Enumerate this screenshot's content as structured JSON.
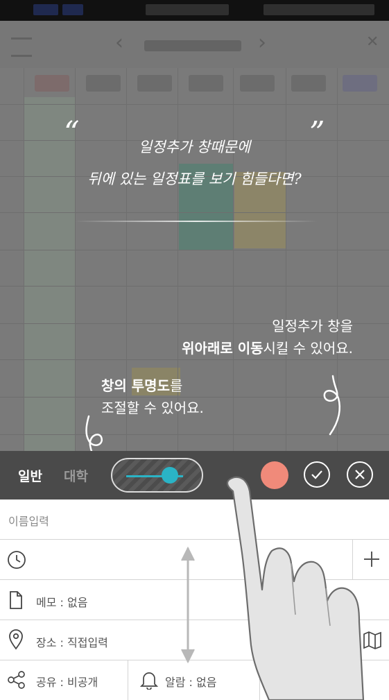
{
  "overlay": {
    "quote_open": "“",
    "quote_close": "”",
    "script_line1": "일정추가 창때문에",
    "script_line2": "뒤에 있는 일정표를 보기 힘들다면?",
    "hint_move_line1": "일정추가 창을",
    "hint_move_bold1": "위아래로 이동",
    "hint_move_rest": "시킬 수 있어요.",
    "hint_opacity_bold": "창의 투명도",
    "hint_opacity_rest": "를",
    "hint_opacity_line2": "조절할 수 있어요."
  },
  "toolbar": {
    "tab_general": "일반",
    "tab_college": "대학",
    "selected_color": "#f08a7a",
    "accent": "#2ab4c6",
    "opacity_slider_value": 0.85
  },
  "form": {
    "name_placeholder": "이름입력",
    "memo_label": "메모 : 없음",
    "place_label": "장소 : 직접입력",
    "share_label": "공유 : 비공개",
    "alarm_label": "알람 : 없음"
  },
  "icons": [
    "clock-icon",
    "plus-icon",
    "document-icon",
    "location-pin-icon",
    "map-icon",
    "share-icon",
    "bell-icon",
    "check-icon",
    "close-icon"
  ]
}
